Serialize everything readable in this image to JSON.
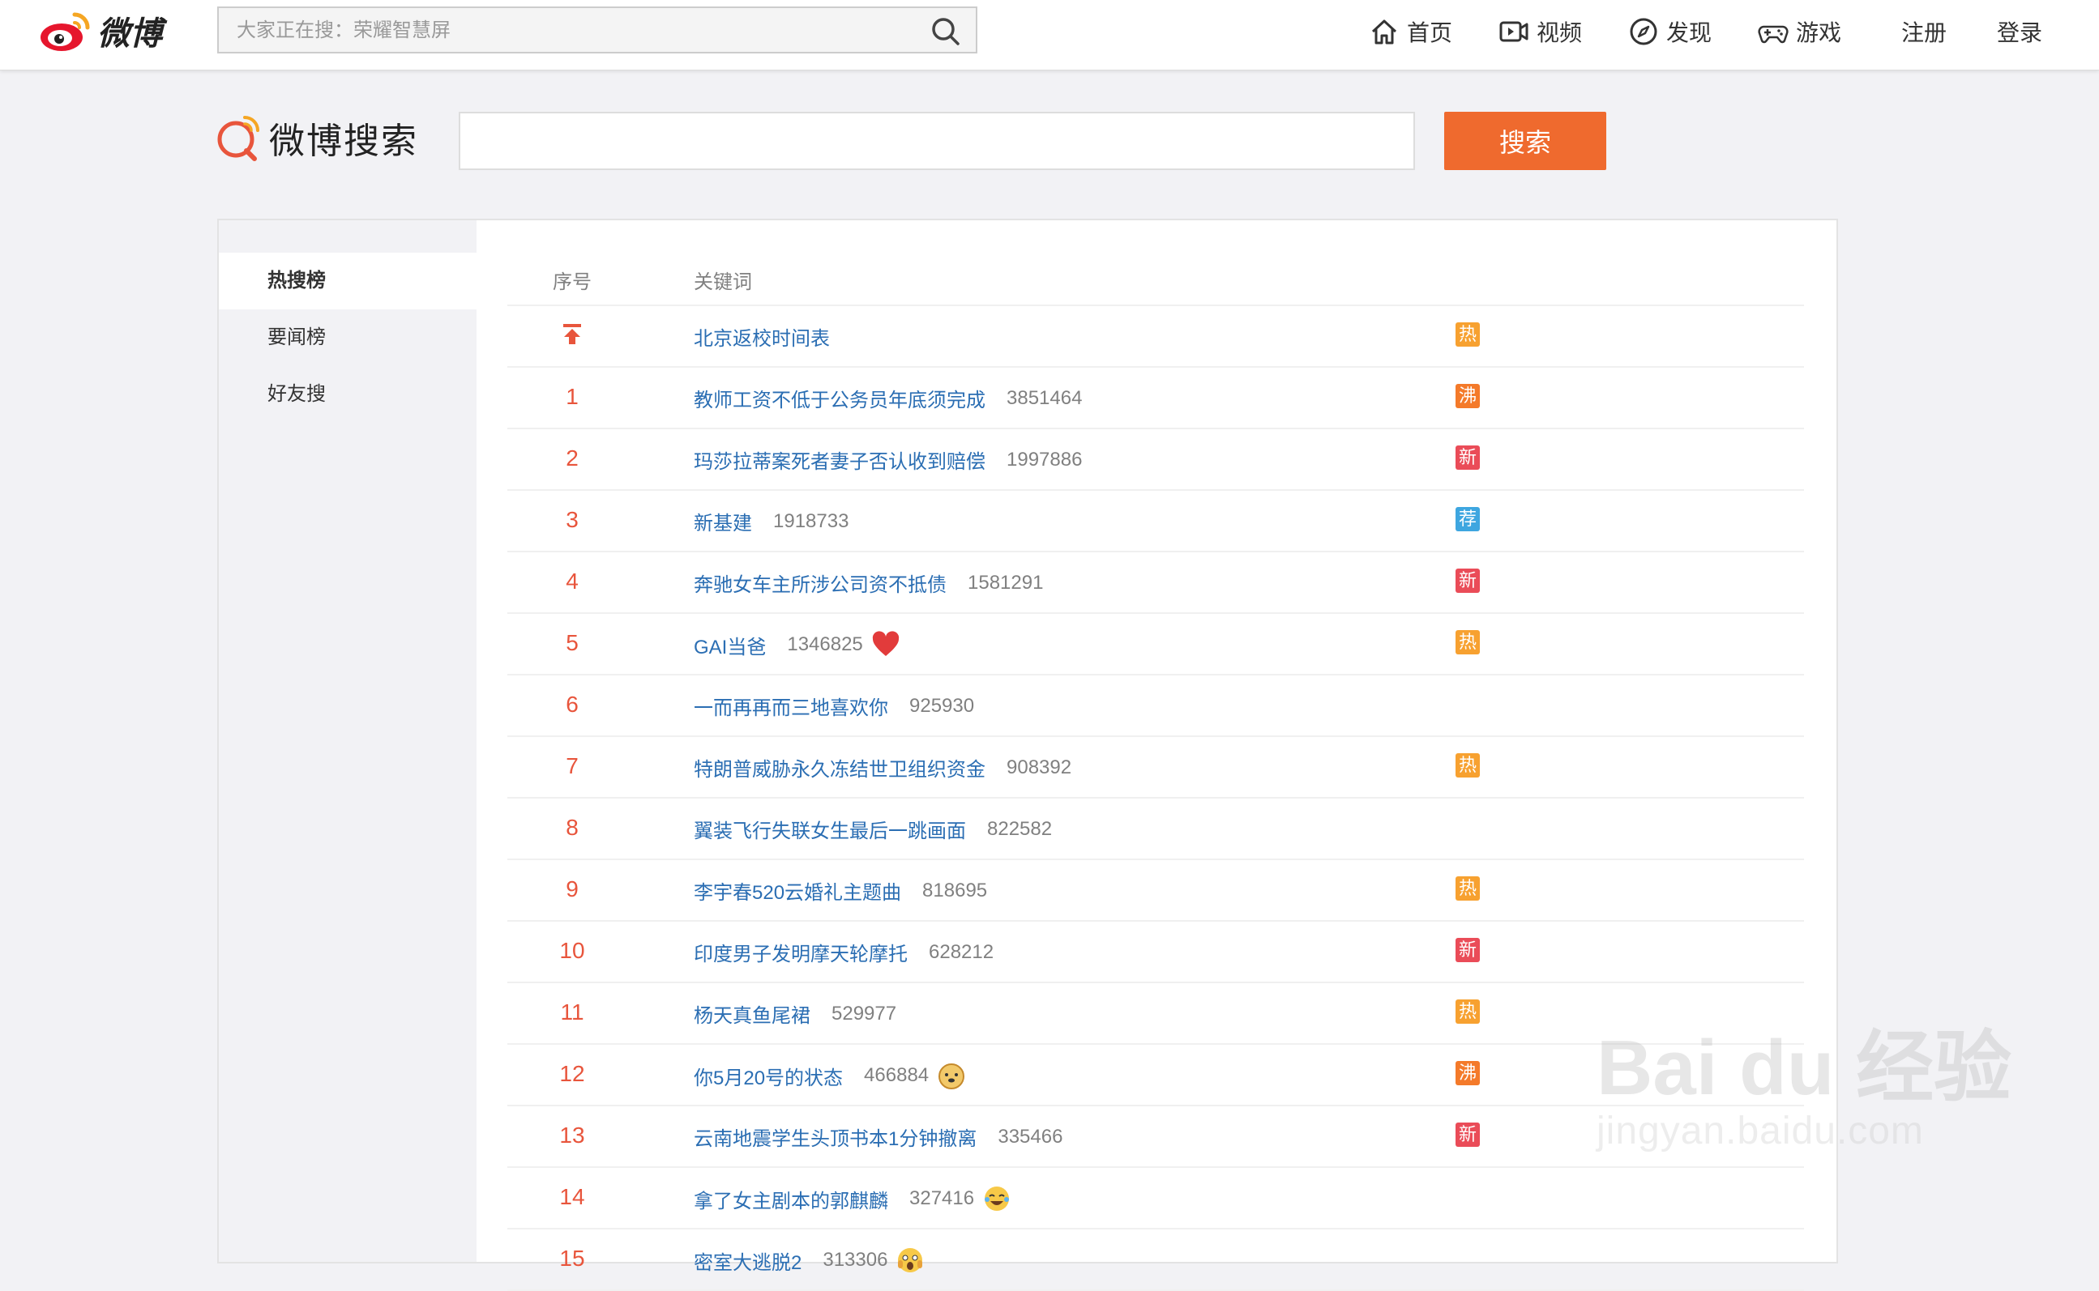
{
  "header": {
    "logo_text": "微博",
    "search_placeholder": "大家正在搜：荣耀智慧屏",
    "nav": [
      {
        "label": "首页",
        "icon": "home-icon"
      },
      {
        "label": "视频",
        "icon": "video-icon"
      },
      {
        "label": "发现",
        "icon": "compass-icon"
      },
      {
        "label": "游戏",
        "icon": "gamepad-icon"
      }
    ],
    "register_label": "注册",
    "login_label": "登录"
  },
  "search": {
    "brand": "微博搜索",
    "button_label": "搜索",
    "input_value": ""
  },
  "sidebar": {
    "items": [
      {
        "label": "热搜榜",
        "active": true
      },
      {
        "label": "要闻榜",
        "active": false
      },
      {
        "label": "好友搜",
        "active": false
      }
    ]
  },
  "table": {
    "col_rank": "序号",
    "col_keyword": "关键词",
    "rows": [
      {
        "rank": "",
        "pinned": true,
        "keyword": "北京返校时间表",
        "count": "",
        "emoji": "",
        "tag": "热",
        "tag_color": "#f7a130"
      },
      {
        "rank": "1",
        "keyword": "教师工资不低于公务员年底须完成",
        "count": "3851464",
        "emoji": "",
        "tag": "沸",
        "tag_color": "#f47a2a"
      },
      {
        "rank": "2",
        "keyword": "玛莎拉蒂案死者妻子否认收到赔偿",
        "count": "1997886",
        "emoji": "",
        "tag": "新",
        "tag_color": "#ea4c58"
      },
      {
        "rank": "3",
        "keyword": "新基建",
        "count": "1918733",
        "emoji": "",
        "tag": "荐",
        "tag_color": "#3ea6e0"
      },
      {
        "rank": "4",
        "keyword": "奔驰女车主所涉公司资不抵债",
        "count": "1581291",
        "emoji": "",
        "tag": "新",
        "tag_color": "#ea4c58"
      },
      {
        "rank": "5",
        "keyword": "GAI当爸",
        "count": "1346825",
        "emoji": "heart-emoji",
        "tag": "热",
        "tag_color": "#f7a130"
      },
      {
        "rank": "6",
        "keyword": "一而再再而三地喜欢你",
        "count": "925930",
        "emoji": "",
        "tag": "",
        "tag_color": ""
      },
      {
        "rank": "7",
        "keyword": "特朗普威胁永久冻结世卫组织资金",
        "count": "908392",
        "emoji": "",
        "tag": "热",
        "tag_color": "#f7a130"
      },
      {
        "rank": "8",
        "keyword": "翼装飞行失联女生最后一跳画面",
        "count": "822582",
        "emoji": "",
        "tag": "",
        "tag_color": ""
      },
      {
        "rank": "9",
        "keyword": "李宇春520云婚礼主题曲",
        "count": "818695",
        "emoji": "",
        "tag": "热",
        "tag_color": "#f7a130"
      },
      {
        "rank": "10",
        "keyword": "印度男子发明摩天轮摩托",
        "count": "628212",
        "emoji": "",
        "tag": "新",
        "tag_color": "#ea4c58"
      },
      {
        "rank": "11",
        "keyword": "杨天真鱼尾裙",
        "count": "529977",
        "emoji": "",
        "tag": "热",
        "tag_color": "#f7a130"
      },
      {
        "rank": "12",
        "keyword": "你5月20号的状态",
        "count": "466884",
        "emoji": "doge-emoji",
        "tag": "沸",
        "tag_color": "#f47a2a"
      },
      {
        "rank": "13",
        "keyword": "云南地震学生头顶书本1分钟撤离",
        "count": "335466",
        "emoji": "",
        "tag": "新",
        "tag_color": "#ea4c58"
      },
      {
        "rank": "14",
        "keyword": "拿了女主剧本的郭麒麟",
        "count": "327416",
        "emoji": "laugh-cry-emoji",
        "tag": "",
        "tag_color": ""
      },
      {
        "rank": "15",
        "keyword": "密室大逃脱2",
        "count": "313306",
        "emoji": "scared-emoji",
        "tag": "",
        "tag_color": ""
      }
    ]
  },
  "watermark": {
    "top": "Bai du 经验",
    "bottom": "jingyan.baidu.com"
  }
}
